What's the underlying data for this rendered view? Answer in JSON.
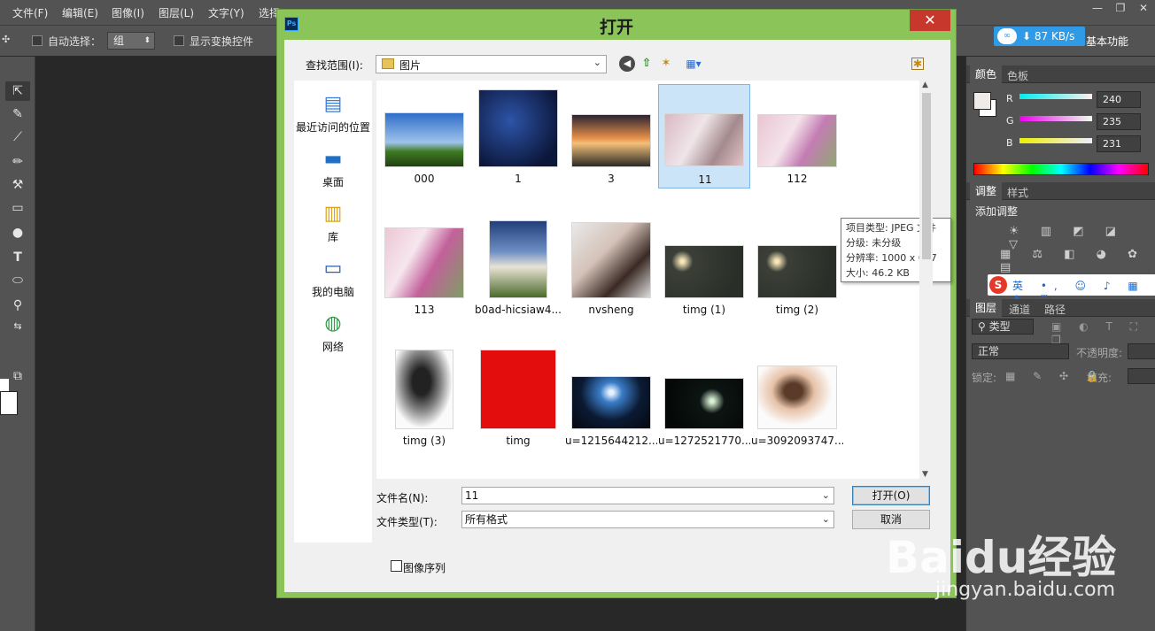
{
  "menu": [
    "文件(F)",
    "编辑(E)",
    "图像(I)",
    "图层(L)",
    "文字(Y)",
    "选择"
  ],
  "window_controls": [
    "—",
    "❐",
    "✕"
  ],
  "options": {
    "auto_select_label": "自动选择：",
    "auto_select_value": "组",
    "show_transform_label": "显示变换控件"
  },
  "net_speed": "87 KB/s",
  "workspace": "基本功能",
  "panels": {
    "color_tab": "颜色",
    "swatch_tab": "色板",
    "r_label": "R",
    "g_label": "G",
    "b_label": "B",
    "r": "240",
    "g": "235",
    "b": "231",
    "adjust_tab": "调整",
    "style_tab": "样式",
    "add_adjust": "添加调整",
    "layers_tab": "图层",
    "channels_tab": "通道",
    "paths_tab": "路径",
    "kind_label": "类型",
    "blend_mode": "正常",
    "opacity_label": "不透明度:",
    "lock_label": "锁定:",
    "fill_label": "填充:",
    "ime_text": "英 •, ☺ ♪ ▦ ♞ ♖"
  },
  "dialog": {
    "title": "打开",
    "close": "✕",
    "look_in_label": "查找范围(I):",
    "look_in_value": "图片",
    "places": [
      {
        "label": "最近访问的位置",
        "icon": "recent-icon"
      },
      {
        "label": "桌面",
        "icon": "desktop-icon"
      },
      {
        "label": "库",
        "icon": "library-icon"
      },
      {
        "label": "我的电脑",
        "icon": "computer-icon"
      },
      {
        "label": "网络",
        "icon": "network-icon"
      }
    ],
    "files": [
      {
        "name": "000"
      },
      {
        "name": "1"
      },
      {
        "name": "3"
      },
      {
        "name": "11"
      },
      {
        "name": "112"
      },
      {
        "name": "113"
      },
      {
        "name": "b0ad-hicsiaw4..."
      },
      {
        "name": "nvsheng"
      },
      {
        "name": "timg (1)"
      },
      {
        "name": "timg (2)"
      },
      {
        "name": "timg (3)"
      },
      {
        "name": "timg"
      },
      {
        "name": "u=1215644212..."
      },
      {
        "name": "u=1272521770..."
      },
      {
        "name": "u=3092093747..."
      }
    ],
    "tooltip": {
      "type": "项目类型: JPEG 文件",
      "rating": "分级: 未分级",
      "resolution": "分辨率: 1000 x 667",
      "size": "大小: 46.2 KB"
    },
    "filename_label": "文件名(N):",
    "filename_value": "11",
    "filetype_label": "文件类型(T):",
    "filetype_value": "所有格式",
    "open_button": "打开(O)",
    "cancel_button": "取消",
    "image_sequence": "图像序列"
  },
  "watermark": {
    "logo": "Baidu经验",
    "url": "jingyan.baidu.com"
  }
}
